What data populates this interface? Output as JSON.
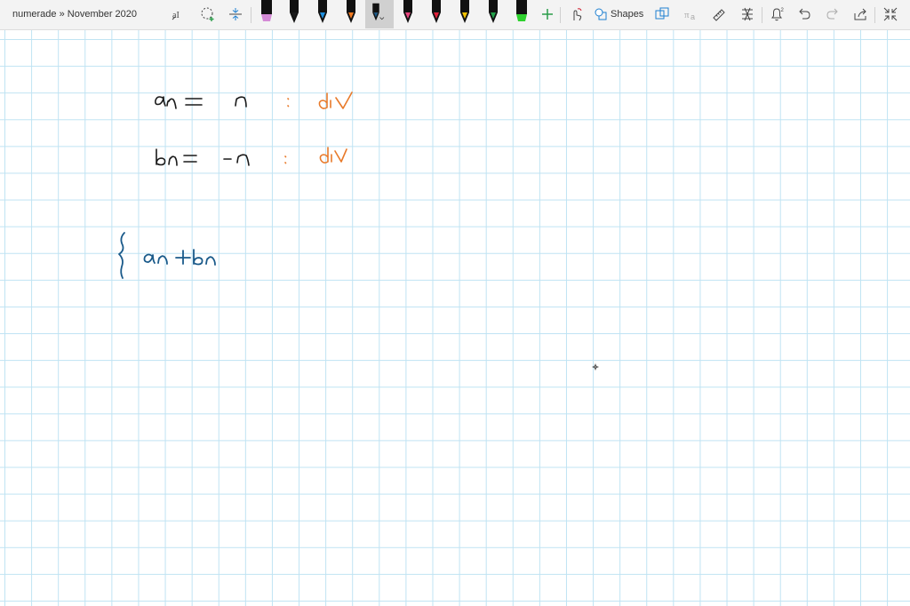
{
  "header": {
    "breadcrumb": "numerade » November 2020"
  },
  "toolbar": {
    "shapes_label": "Shapes",
    "notification_count": "2",
    "pens": [
      {
        "name": "highlighter-pink",
        "color": "#d48ad6"
      },
      {
        "name": "pen-black",
        "color": "#1a1a1a"
      },
      {
        "name": "pen-blue",
        "color": "#1e90e0"
      },
      {
        "name": "pen-orange",
        "color": "#f07a21"
      },
      {
        "name": "pen-darkblue",
        "color": "#1a5a8a"
      },
      {
        "name": "pen-pink",
        "color": "#e8467f"
      },
      {
        "name": "pen-red",
        "color": "#e0203a"
      },
      {
        "name": "pen-yellow",
        "color": "#f2c200"
      },
      {
        "name": "pen-green",
        "color": "#22a14a"
      },
      {
        "name": "highlighter-green",
        "color": "#2ed12e"
      }
    ],
    "selected_pen": "pen-darkblue",
    "icons": [
      "lasso-text-icon",
      "lasso-select-icon",
      "insert-space-icon",
      "add-pen-icon",
      "touch-writing-icon",
      "shapes-icon",
      "ink-to-shape-icon",
      "ink-to-math-icon",
      "ruler-icon",
      "replay-icon",
      "notifications-icon",
      "undo-icon",
      "redo-icon",
      "share-icon",
      "fullscreen-icon"
    ]
  },
  "ink_colors": {
    "main": "#1a1a1a",
    "accent": "#e87a2a",
    "blue": "#1a5a8a"
  }
}
